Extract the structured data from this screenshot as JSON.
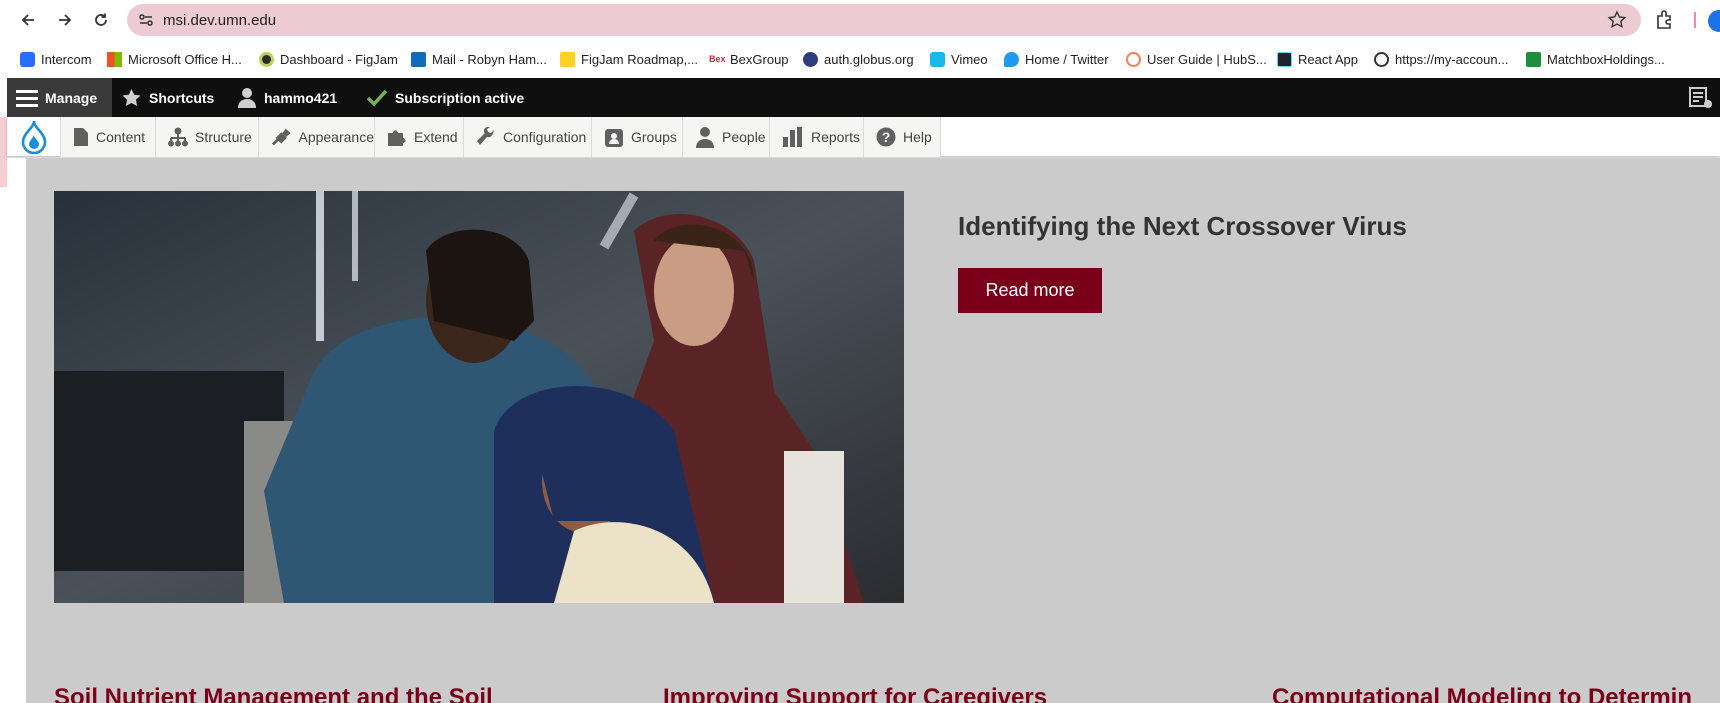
{
  "browser": {
    "url": "msi.dev.umn.edu",
    "bookmarks": [
      {
        "label": "Intercom",
        "icon": "intercom-icon"
      },
      {
        "label": "Microsoft Office H...",
        "icon": "microsoft-icon"
      },
      {
        "label": "Dashboard - FigJam",
        "icon": "figjam-icon"
      },
      {
        "label": "Mail - Robyn Ham...",
        "icon": "outlook-icon"
      },
      {
        "label": "FigJam Roadmap,...",
        "icon": "figjam-roadmap-icon"
      },
      {
        "label": "BexGroup",
        "icon": "bex-icon"
      },
      {
        "label": "auth.globus.org",
        "icon": "globus-icon"
      },
      {
        "label": "Vimeo",
        "icon": "vimeo-icon"
      },
      {
        "label": "Home / Twitter",
        "icon": "twitter-icon"
      },
      {
        "label": "User Guide | HubS...",
        "icon": "hubspot-icon"
      },
      {
        "label": "React App",
        "icon": "react-icon"
      },
      {
        "label": "https://my-accoun...",
        "icon": "globe-icon"
      },
      {
        "label": "MatchboxHoldings...",
        "icon": "sheets-icon"
      }
    ]
  },
  "admin_toolbar": {
    "manage": "Manage",
    "shortcuts": "Shortcuts",
    "user": "hammo421",
    "subscription": "Subscription active"
  },
  "admin_menu": {
    "items": [
      "Content",
      "Structure",
      "Appearance",
      "Extend",
      "Configuration",
      "Groups",
      "People",
      "Reports",
      "Help"
    ]
  },
  "hero": {
    "title": "Identifying the Next Crossover Virus",
    "button": "Read more"
  },
  "cards": [
    {
      "title": "Soil Nutrient Management and the Soil"
    },
    {
      "title": "Improving Support for Caregivers"
    },
    {
      "title": "Computational Modeling to Determin"
    }
  ],
  "colors": {
    "brand_maroon": "#7a0019",
    "omnibox": "#eccbd2",
    "page_bg": "#cbcbcb"
  }
}
